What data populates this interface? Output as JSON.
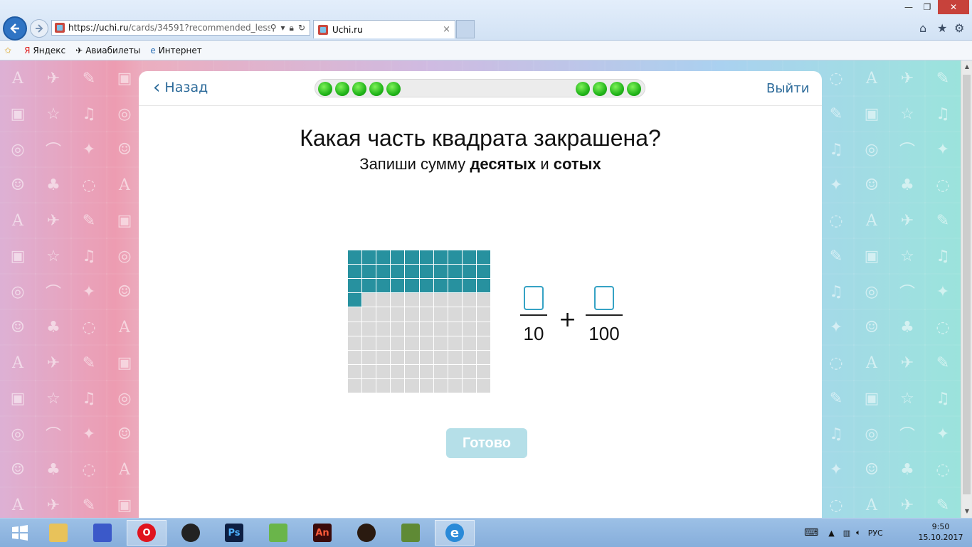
{
  "browser": {
    "url_host": "https://uchi.ru",
    "url_path": "/cards/34591?recommended_lesson=",
    "tab_title": "Uchi.ru",
    "tab_close": "×"
  },
  "favorites": [
    {
      "label": "Яндекс",
      "icon": "yandex-icon"
    },
    {
      "label": "Авиабилеты",
      "icon": "plane-icon"
    },
    {
      "label": "Интернет",
      "icon": "ie-page-icon"
    }
  ],
  "card": {
    "back_label": "Назад",
    "exit_label": "Выйти",
    "progress": {
      "left_done": 5,
      "right_done": 4
    },
    "question": "Какая часть квадрата закрашена?",
    "subtitle_pre": "Запиши сумму",
    "subtitle_bold1": "десятых",
    "subtitle_mid": "и",
    "subtitle_bold2": "сотых",
    "grid": {
      "rows": 10,
      "cols": 10,
      "filled_cells": 31,
      "filled_color": "#27919f",
      "empty_color": "#d9d9d9"
    },
    "fraction1_den": "10",
    "plus": "+",
    "fraction2_den": "100",
    "done_label": "Готово"
  },
  "taskbar": {
    "apps": [
      "start-icon",
      "file-explorer-icon",
      "save-disk-icon",
      "opera-icon",
      "obs-icon",
      "photoshop-icon",
      "minecraft-launcher-icon",
      "animate-icon",
      "game-icon",
      "minecraft-icon",
      "internet-explorer-icon"
    ],
    "lang": "РУС",
    "time": "9:50",
    "date": "15.10.2017"
  }
}
